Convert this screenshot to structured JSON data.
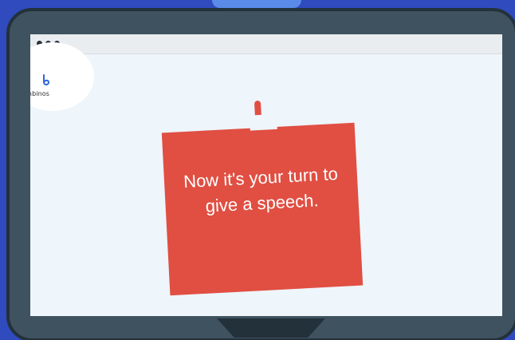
{
  "browser": {
    "window_controls": [
      "dot",
      "dot",
      "dot"
    ]
  },
  "logo": {
    "name": "bambinos",
    "icon": "letter-b-icon"
  },
  "message_card": {
    "text": "Now it's your turn to give a speech."
  },
  "colors": {
    "page_background": "#2f4bbd",
    "device_bezel": "#3f525f",
    "screen_background": "#eef5fb",
    "card_background": "#e04f42",
    "card_text": "#ffffff"
  }
}
